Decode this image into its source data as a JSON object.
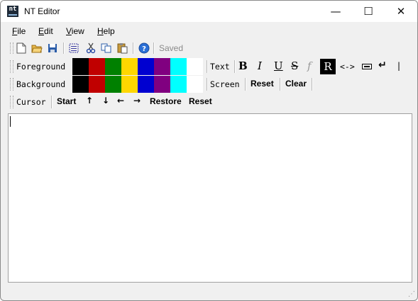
{
  "window": {
    "title": "NT Editor",
    "icon_text": "nt"
  },
  "window_buttons": {
    "minimize": "—",
    "maximize": "☐",
    "close": "✕"
  },
  "menu": [
    {
      "label": "File",
      "accel": "F",
      "rest": "ile"
    },
    {
      "label": "Edit",
      "accel": "E",
      "rest": "dit"
    },
    {
      "label": "View",
      "accel": "V",
      "rest": "iew"
    },
    {
      "label": "Help",
      "accel": "H",
      "rest": "elp"
    }
  ],
  "toolbar": {
    "icons": [
      "new-file-icon",
      "open-folder-icon",
      "save-disk-icon",
      "select-all-icon",
      "cut-scissors-icon",
      "copy-icon",
      "paste-icon",
      "help-icon"
    ],
    "status": "Saved"
  },
  "foreground_bar": {
    "label": "Foreground",
    "colors": [
      "#000000",
      "#c00000",
      "#008000",
      "#ffd700",
      "#0000d0",
      "#800080",
      "#00ffff",
      "#ffffff"
    ],
    "text_label": "Text",
    "bold": "B",
    "italic": "I",
    "underline": "U",
    "strike": "S",
    "function": "f",
    "reverse": "R",
    "arrows": "<->",
    "linebreak": "↵",
    "bar": "|"
  },
  "background_bar": {
    "label": "Background",
    "colors": [
      "#000000",
      "#c00000",
      "#008000",
      "#ffd700",
      "#0000d0",
      "#800080",
      "#00ffff",
      "#ffffff"
    ],
    "screen_label": "Screen",
    "reset": "Reset",
    "clear": "Clear"
  },
  "cursor_bar": {
    "label": "Cursor",
    "start": "Start",
    "up": "↑",
    "down": "↓",
    "left": "←",
    "right": "→",
    "restore": "Restore",
    "reset": "Reset"
  },
  "editor": {
    "content": ""
  }
}
